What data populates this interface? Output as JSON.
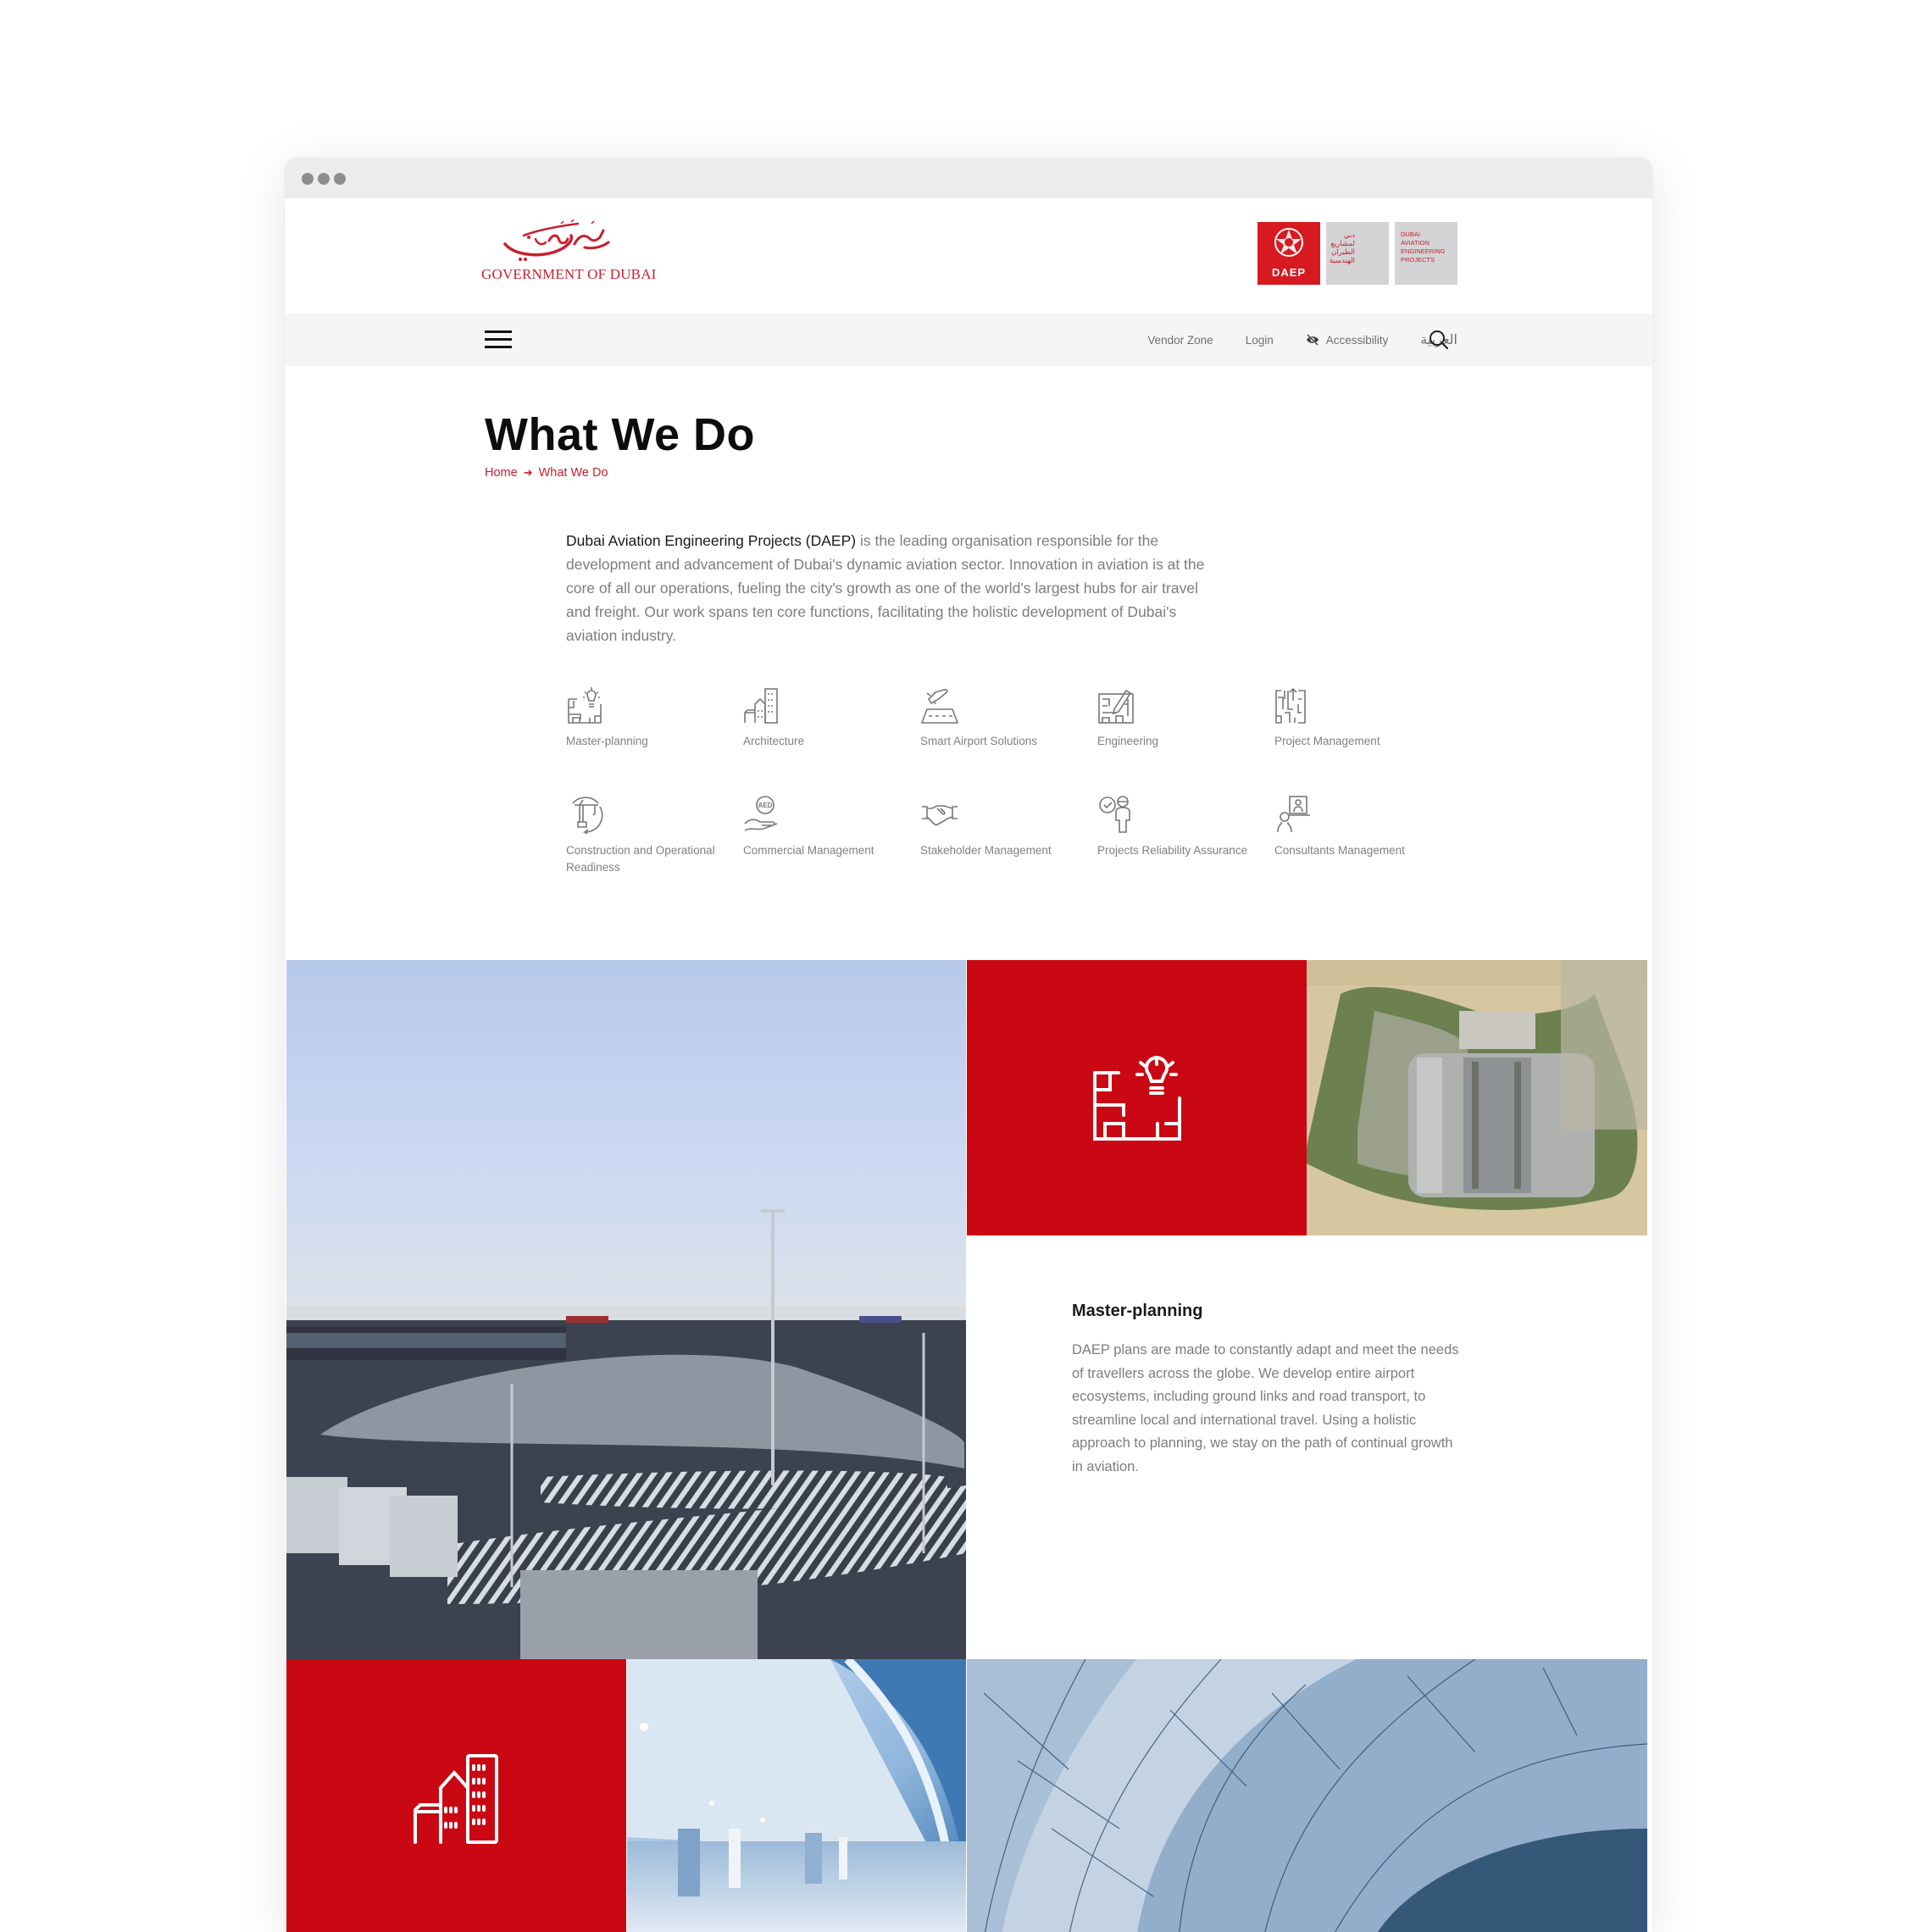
{
  "window": {
    "controls": [
      "dot",
      "dot",
      "dot"
    ]
  },
  "header": {
    "gov_logo_text": "GOVERNMENT OF DUBAI",
    "gov_logo_arabic": "حكومة دبي",
    "daep_logo": {
      "mark_text": "DAEP",
      "arabic_lines": [
        "دبي",
        "لمشاريع",
        "الطيران",
        "الهندسية"
      ],
      "english_lines": [
        "DUBAI",
        "AVIATION",
        "ENGINEERING",
        "PROJECTS"
      ]
    }
  },
  "nav": {
    "menu_icon": "hamburger-icon",
    "links": [
      {
        "label": "Vendor Zone"
      },
      {
        "label": "Login"
      },
      {
        "label": "Accessibility",
        "icon": "eye-slash-icon"
      },
      {
        "label": "العربية"
      }
    ],
    "search_icon": "search-icon"
  },
  "page": {
    "title": "What We Do",
    "breadcrumb": [
      {
        "label": "Home"
      },
      {
        "label": "What We Do"
      }
    ],
    "intro_strong": "Dubai Aviation Engineering Projects (DAEP)",
    "intro_rest": " is the leading organisation responsible for the development and advancement of Dubai's dynamic aviation sector. Innovation in aviation is at the core of all our operations, fueling the city's growth as one of the world's largest hubs for air travel and freight. Our work spans ten core functions, facilitating the holistic development of Dubai's aviation industry."
  },
  "functions": [
    {
      "label": "Master-planning",
      "icon": "master-planning-icon"
    },
    {
      "label": "Architecture",
      "icon": "architecture-icon"
    },
    {
      "label": "Smart Airport Solutions",
      "icon": "smart-airport-icon"
    },
    {
      "label": "Engineering",
      "icon": "engineering-icon"
    },
    {
      "label": "Project Management",
      "icon": "project-management-icon"
    },
    {
      "label": "Construction and Operational Readiness",
      "icon": "construction-icon"
    },
    {
      "label": "Commercial Management",
      "icon": "commercial-management-icon"
    },
    {
      "label": "Stakeholder Management",
      "icon": "handshake-icon"
    },
    {
      "label": "Projects Reliability Assurance",
      "icon": "reliability-icon"
    },
    {
      "label": "Consultants Management",
      "icon": "consultants-icon"
    }
  ],
  "feature": {
    "title": "Master-planning",
    "text": "DAEP plans are made to constantly adapt and meet the needs of travellers across the globe. We develop entire airport ecosystems, including ground links and road transport, to streamline local and international travel. Using a holistic approach to planning, we stay on the path of continual growth in aviation.",
    "photos": [
      "airport-apron-photo",
      "aerial-masterplan-photo",
      "terminal-interior-photo",
      "curved-architecture-photo"
    ]
  },
  "colors": {
    "brand_red": "#c90813",
    "breadcrumb_red": "#c8202f",
    "nav_bg": "#f5f5f5",
    "text_grey": "#7d7d7d"
  }
}
